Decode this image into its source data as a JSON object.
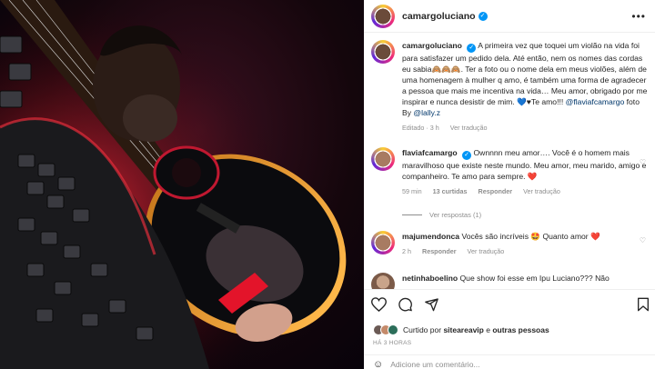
{
  "post": {
    "author": "camargoluciano",
    "more_label": "•••"
  },
  "caption": {
    "author": "camargoluciano",
    "text": "A primeira vez que toquei um violão na vida foi para satisfazer um pedido dela. Até então, nem os nomes das cordas eu sabia🙈🙈🙈. Ter a foto ou o nome dela em meus violões, além de uma homenagem à mulher q amo, é também uma forma de agradecer a pessoa que mais me incentiva na vida… Meu amor, obrigado por me inspirar e nunca desistir de mim. 💙♥Te amo!!!",
    "mention1": "@flaviafcamargo",
    "foto_by": "foto By",
    "mention2": "@lally.z",
    "edited": "Editado · 3 h",
    "see_translation": "Ver tradução"
  },
  "comments": [
    {
      "author": "flaviafcamargo",
      "text": "Ownnnn meu amor…. Você é o homem mais maravilhoso que existe neste mundo. Meu amor, meu marido, amigo e companheiro. Te amo para sempre. ❤️",
      "time": "59 min",
      "likes": "13 curtidas",
      "reply": "Responder",
      "see_translation": "Ver tradução",
      "view_replies": "Ver respostas (1)"
    },
    {
      "author": "majumendonca",
      "text": "Vocês são incríveis 🤩 Quanto amor ❤️",
      "time": "2 h",
      "reply": "Responder",
      "see_translation": "Ver tradução"
    },
    {
      "author": "netinhaboelino",
      "text": "Que show foi esse em Ipu Luciano??? Não"
    }
  ],
  "liked_by": {
    "prefix": "Curtido por",
    "user": "sitearеavip",
    "suffix": "e",
    "others": "outras pessoas"
  },
  "timestamp": "HÁ 3 HORAS",
  "add_comment_placeholder": "Adicione um comentário...",
  "icons": {
    "like": "heart-icon",
    "comment": "comment-icon",
    "share": "share-icon",
    "save": "bookmark-icon",
    "emoji": "emoji-icon",
    "verified": "verified-badge-icon"
  },
  "colors": {
    "verified_blue": "#0095f6",
    "mention": "#00376b",
    "muted": "#8e8e8e",
    "text": "#262626",
    "stage_red": "#e3142a"
  }
}
